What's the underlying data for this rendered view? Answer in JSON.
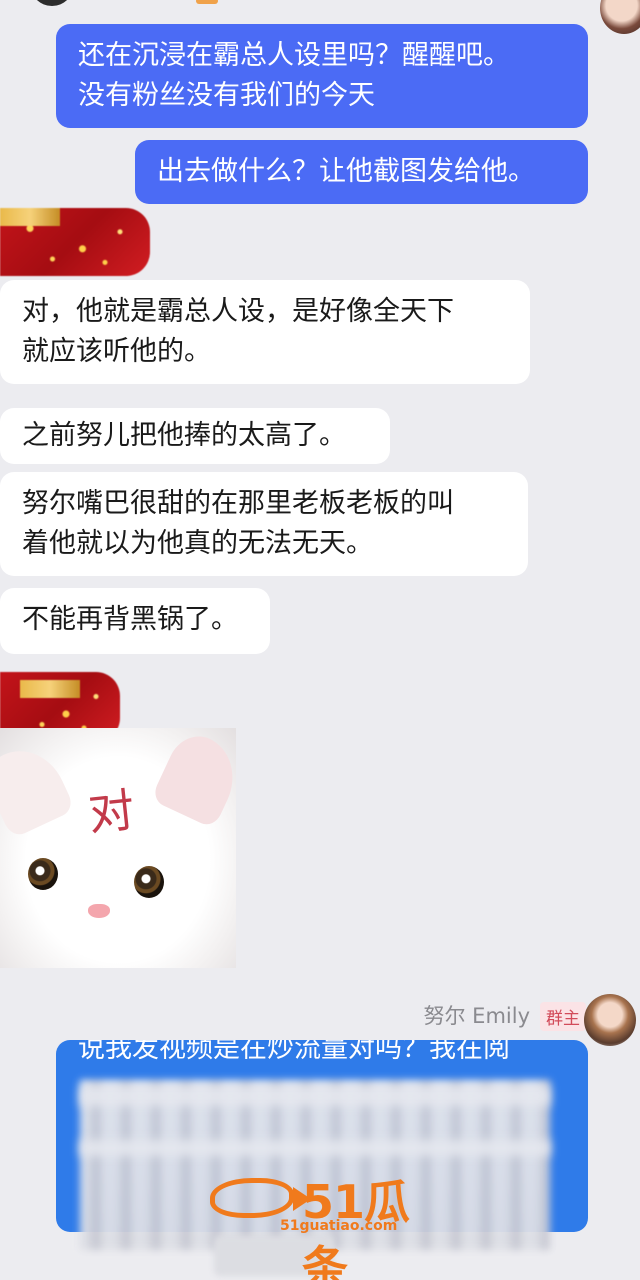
{
  "messages": {
    "out1": {
      "line1": "还在沉浸在霸总人设里吗？醒醒吧。",
      "line2": "没有粉丝没有我们的今天"
    },
    "out2": {
      "text": "出去做什么？让他截图发给他。"
    },
    "in1": {
      "line1": "对，他就是霸总人设，是好像全天下",
      "line2": "就应该听他的。"
    },
    "in2": {
      "text": "之前努儿把他捧的太高了。"
    },
    "in3": {
      "line1": "努尔嘴巴很甜的在那里老板老板的叫",
      "line2": "着他就以为他真的无法无天。"
    },
    "in4": {
      "text": "不能再背黑锅了。"
    }
  },
  "sticker": {
    "text": "对"
  },
  "last_message": {
    "sender_name": "努尔 Emily",
    "badge": "群主",
    "visible_text": "说我发视频是在炒流量对吗？我在阅"
  },
  "watermark": {
    "brand": "51瓜条",
    "url": "51guatiao.com"
  },
  "colors": {
    "outgoing_bubble": "#4b6bf5",
    "highlight_bubble": "#2f7be9",
    "incoming_bubble": "#ffffff",
    "background": "#ececf0",
    "watermark": "#f07a1c"
  }
}
